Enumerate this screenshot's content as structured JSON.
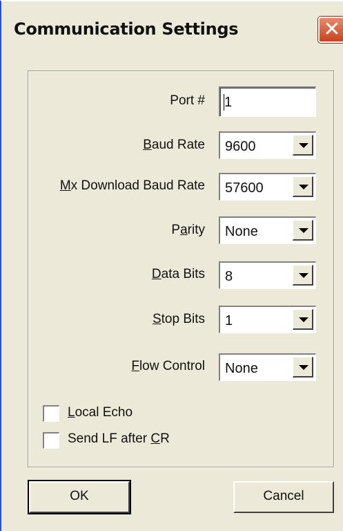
{
  "window": {
    "title": "Communication Settings"
  },
  "fields": {
    "port": {
      "label": "Port #",
      "value": "1"
    },
    "baud_rate": {
      "label_pre": "",
      "label_key": "B",
      "label_post": "aud Rate",
      "value": "9600"
    },
    "mx_download": {
      "label_pre": "",
      "label_key": "M",
      "label_post": "x Download Baud Rate",
      "value": "57600"
    },
    "parity": {
      "label_pre": "P",
      "label_key": "a",
      "label_post": "rity",
      "value": "None"
    },
    "data_bits": {
      "label_pre": "",
      "label_key": "D",
      "label_post": "ata Bits",
      "value": "8"
    },
    "stop_bits": {
      "label_pre": "",
      "label_key": "S",
      "label_post": "top Bits",
      "value": "1"
    },
    "flow_control": {
      "label_pre": "",
      "label_key": "F",
      "label_post": "low Control",
      "value": "None"
    }
  },
  "options": {
    "local_echo": {
      "label_pre": "",
      "label_key": "L",
      "label_post": "ocal Echo",
      "checked": false
    },
    "send_lf": {
      "label_pre": "Send LF after ",
      "label_key": "C",
      "label_post": "R",
      "checked": false
    }
  },
  "buttons": {
    "ok": "OK",
    "cancel": "Cancel"
  },
  "icons": {
    "close": "close-icon",
    "dropdown": "chevron-down-icon"
  }
}
